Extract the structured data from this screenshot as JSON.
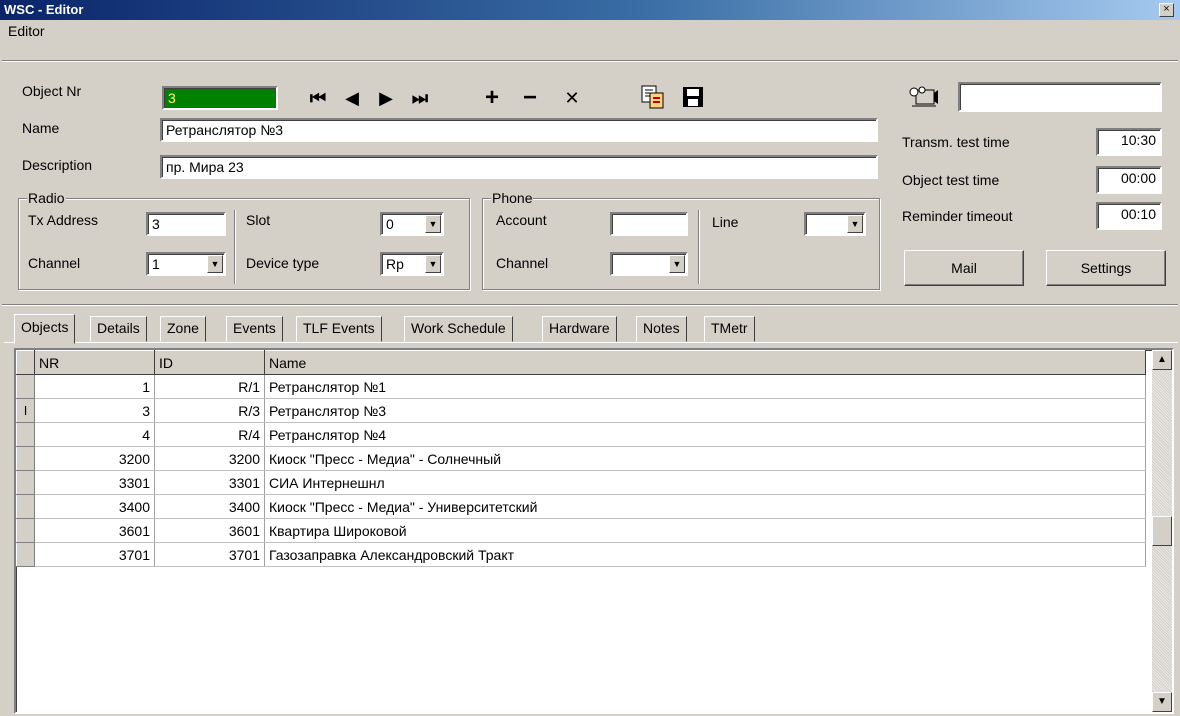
{
  "window": {
    "title": "WSC - Editor",
    "close_glyph": "×"
  },
  "menu": {
    "editor": "Editor"
  },
  "form": {
    "object_nr_label": "Object Nr",
    "object_nr": "3",
    "name_label": "Name",
    "name": "Ретранслятор №3",
    "description_label": "Description",
    "description": "пр. Мира 23"
  },
  "nav": {
    "first": "⏮",
    "prev": "◀",
    "next": "▶",
    "last": "⏭",
    "add": "+",
    "delete": "−",
    "cancel": "✕"
  },
  "radio": {
    "title": "Radio",
    "tx_address_label": "Tx Address",
    "tx_address": "3",
    "slot_label": "Slot",
    "slot": "0",
    "channel_label": "Channel",
    "channel": "1",
    "device_type_label": "Device type",
    "device_type": "Rp"
  },
  "phone": {
    "title": "Phone",
    "account_label": "Account",
    "account": "",
    "line_label": "Line",
    "line": "",
    "channel_label": "Channel",
    "channel": ""
  },
  "right": {
    "camera_field": "",
    "transm_label": "Transm. test time",
    "transm": "10:30",
    "object_test_label": "Object test time",
    "object_test": "00:00",
    "reminder_label": "Reminder timeout",
    "reminder": "00:10",
    "mail_button": "Mail",
    "settings_button": "Settings"
  },
  "tabs": [
    "Objects",
    "Details",
    "Zone",
    "Events",
    "TLF Events",
    "Work Schedule",
    "Hardware",
    "Notes",
    "TMetr"
  ],
  "grid": {
    "headers": [
      "NR",
      "ID",
      "Name"
    ],
    "current_marker": "I",
    "rows": [
      {
        "nr": "1",
        "id": "R/1",
        "name": "Ретранслятор №1"
      },
      {
        "nr": "3",
        "id": "R/3",
        "name": "Ретранслятор №3"
      },
      {
        "nr": "4",
        "id": "R/4",
        "name": "Ретранслятор №4"
      },
      {
        "nr": "3200",
        "id": "3200",
        "name": "Киоск \"Пресс - Медиа\" - Солнечный"
      },
      {
        "nr": "3301",
        "id": "3301",
        "name": "СИА Интернешнл"
      },
      {
        "nr": "3400",
        "id": "3400",
        "name": "Киоск \"Пресс - Медиа\" - Университетский"
      },
      {
        "nr": "3601",
        "id": "3601",
        "name": "Квартира Широковой"
      },
      {
        "nr": "3701",
        "id": "3701",
        "name": "Газозаправка Александровский Тракт"
      }
    ]
  }
}
